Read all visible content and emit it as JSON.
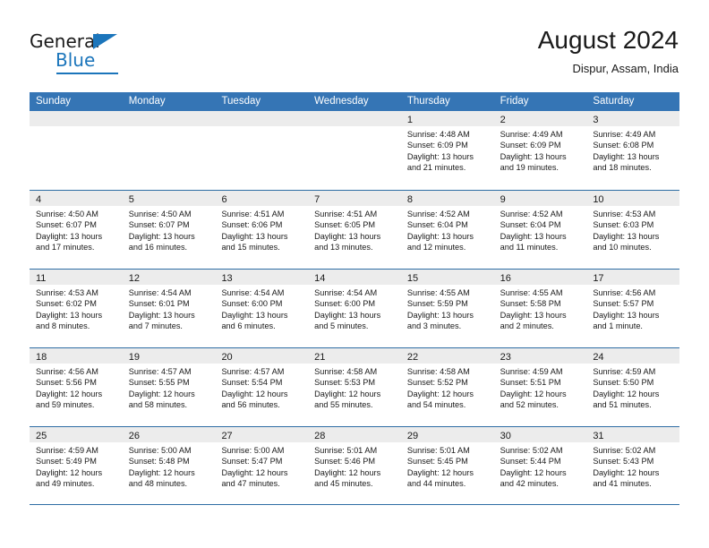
{
  "brand": {
    "name_part1": "General",
    "name_part2": "Blue",
    "triangle_icon": "triangle-icon",
    "accent_color": "#1b75bb"
  },
  "header": {
    "title": "August 2024",
    "subtitle": "Dispur, Assam, India"
  },
  "calendar": {
    "header_bg": "#3575b5",
    "day_band_bg": "#ececec",
    "border_color": "#2e6da4",
    "weekdays": [
      "Sunday",
      "Monday",
      "Tuesday",
      "Wednesday",
      "Thursday",
      "Friday",
      "Saturday"
    ],
    "weeks": [
      [
        {
          "day": "",
          "lines": []
        },
        {
          "day": "",
          "lines": []
        },
        {
          "day": "",
          "lines": []
        },
        {
          "day": "",
          "lines": []
        },
        {
          "day": "1",
          "lines": [
            "Sunrise: 4:48 AM",
            "Sunset: 6:09 PM",
            "Daylight: 13 hours",
            "and 21 minutes."
          ]
        },
        {
          "day": "2",
          "lines": [
            "Sunrise: 4:49 AM",
            "Sunset: 6:09 PM",
            "Daylight: 13 hours",
            "and 19 minutes."
          ]
        },
        {
          "day": "3",
          "lines": [
            "Sunrise: 4:49 AM",
            "Sunset: 6:08 PM",
            "Daylight: 13 hours",
            "and 18 minutes."
          ]
        }
      ],
      [
        {
          "day": "4",
          "lines": [
            "Sunrise: 4:50 AM",
            "Sunset: 6:07 PM",
            "Daylight: 13 hours",
            "and 17 minutes."
          ]
        },
        {
          "day": "5",
          "lines": [
            "Sunrise: 4:50 AM",
            "Sunset: 6:07 PM",
            "Daylight: 13 hours",
            "and 16 minutes."
          ]
        },
        {
          "day": "6",
          "lines": [
            "Sunrise: 4:51 AM",
            "Sunset: 6:06 PM",
            "Daylight: 13 hours",
            "and 15 minutes."
          ]
        },
        {
          "day": "7",
          "lines": [
            "Sunrise: 4:51 AM",
            "Sunset: 6:05 PM",
            "Daylight: 13 hours",
            "and 13 minutes."
          ]
        },
        {
          "day": "8",
          "lines": [
            "Sunrise: 4:52 AM",
            "Sunset: 6:04 PM",
            "Daylight: 13 hours",
            "and 12 minutes."
          ]
        },
        {
          "day": "9",
          "lines": [
            "Sunrise: 4:52 AM",
            "Sunset: 6:04 PM",
            "Daylight: 13 hours",
            "and 11 minutes."
          ]
        },
        {
          "day": "10",
          "lines": [
            "Sunrise: 4:53 AM",
            "Sunset: 6:03 PM",
            "Daylight: 13 hours",
            "and 10 minutes."
          ]
        }
      ],
      [
        {
          "day": "11",
          "lines": [
            "Sunrise: 4:53 AM",
            "Sunset: 6:02 PM",
            "Daylight: 13 hours",
            "and 8 minutes."
          ]
        },
        {
          "day": "12",
          "lines": [
            "Sunrise: 4:54 AM",
            "Sunset: 6:01 PM",
            "Daylight: 13 hours",
            "and 7 minutes."
          ]
        },
        {
          "day": "13",
          "lines": [
            "Sunrise: 4:54 AM",
            "Sunset: 6:00 PM",
            "Daylight: 13 hours",
            "and 6 minutes."
          ]
        },
        {
          "day": "14",
          "lines": [
            "Sunrise: 4:54 AM",
            "Sunset: 6:00 PM",
            "Daylight: 13 hours",
            "and 5 minutes."
          ]
        },
        {
          "day": "15",
          "lines": [
            "Sunrise: 4:55 AM",
            "Sunset: 5:59 PM",
            "Daylight: 13 hours",
            "and 3 minutes."
          ]
        },
        {
          "day": "16",
          "lines": [
            "Sunrise: 4:55 AM",
            "Sunset: 5:58 PM",
            "Daylight: 13 hours",
            "and 2 minutes."
          ]
        },
        {
          "day": "17",
          "lines": [
            "Sunrise: 4:56 AM",
            "Sunset: 5:57 PM",
            "Daylight: 13 hours",
            "and 1 minute."
          ]
        }
      ],
      [
        {
          "day": "18",
          "lines": [
            "Sunrise: 4:56 AM",
            "Sunset: 5:56 PM",
            "Daylight: 12 hours",
            "and 59 minutes."
          ]
        },
        {
          "day": "19",
          "lines": [
            "Sunrise: 4:57 AM",
            "Sunset: 5:55 PM",
            "Daylight: 12 hours",
            "and 58 minutes."
          ]
        },
        {
          "day": "20",
          "lines": [
            "Sunrise: 4:57 AM",
            "Sunset: 5:54 PM",
            "Daylight: 12 hours",
            "and 56 minutes."
          ]
        },
        {
          "day": "21",
          "lines": [
            "Sunrise: 4:58 AM",
            "Sunset: 5:53 PM",
            "Daylight: 12 hours",
            "and 55 minutes."
          ]
        },
        {
          "day": "22",
          "lines": [
            "Sunrise: 4:58 AM",
            "Sunset: 5:52 PM",
            "Daylight: 12 hours",
            "and 54 minutes."
          ]
        },
        {
          "day": "23",
          "lines": [
            "Sunrise: 4:59 AM",
            "Sunset: 5:51 PM",
            "Daylight: 12 hours",
            "and 52 minutes."
          ]
        },
        {
          "day": "24",
          "lines": [
            "Sunrise: 4:59 AM",
            "Sunset: 5:50 PM",
            "Daylight: 12 hours",
            "and 51 minutes."
          ]
        }
      ],
      [
        {
          "day": "25",
          "lines": [
            "Sunrise: 4:59 AM",
            "Sunset: 5:49 PM",
            "Daylight: 12 hours",
            "and 49 minutes."
          ]
        },
        {
          "day": "26",
          "lines": [
            "Sunrise: 5:00 AM",
            "Sunset: 5:48 PM",
            "Daylight: 12 hours",
            "and 48 minutes."
          ]
        },
        {
          "day": "27",
          "lines": [
            "Sunrise: 5:00 AM",
            "Sunset: 5:47 PM",
            "Daylight: 12 hours",
            "and 47 minutes."
          ]
        },
        {
          "day": "28",
          "lines": [
            "Sunrise: 5:01 AM",
            "Sunset: 5:46 PM",
            "Daylight: 12 hours",
            "and 45 minutes."
          ]
        },
        {
          "day": "29",
          "lines": [
            "Sunrise: 5:01 AM",
            "Sunset: 5:45 PM",
            "Daylight: 12 hours",
            "and 44 minutes."
          ]
        },
        {
          "day": "30",
          "lines": [
            "Sunrise: 5:02 AM",
            "Sunset: 5:44 PM",
            "Daylight: 12 hours",
            "and 42 minutes."
          ]
        },
        {
          "day": "31",
          "lines": [
            "Sunrise: 5:02 AM",
            "Sunset: 5:43 PM",
            "Daylight: 12 hours",
            "and 41 minutes."
          ]
        }
      ]
    ]
  }
}
